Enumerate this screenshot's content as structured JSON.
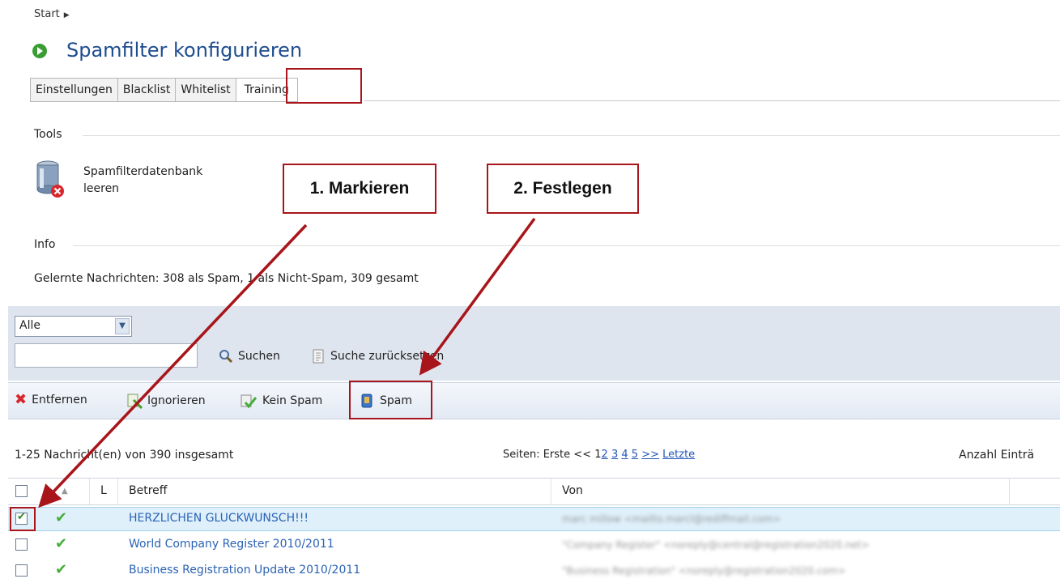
{
  "breadcrumb": {
    "start": "Start",
    "arrow": "▶"
  },
  "title": "Spamfilter konfigurieren",
  "tabs": [
    "Einstellungen",
    "Blacklist",
    "Whitelist",
    "Training"
  ],
  "active_tab": "Training",
  "tools": {
    "heading": "Tools",
    "db_line1": "Spamfilterdatenbank",
    "db_line2": "leeren",
    "db_icon": "database-delete-icon"
  },
  "annotations": {
    "step1": "1. Markieren",
    "step2": "2. Festlegen"
  },
  "info": {
    "heading": "Info",
    "text": "Gelernte Nachrichten: 308 als Spam, 1 als Nicht-Spam, 309 gesamt"
  },
  "filter": {
    "select_value": "Alle",
    "search_value": "",
    "search_label": "Suchen",
    "reset_label": "Suche zurücksetzen"
  },
  "toolbar": {
    "remove": "Entfernen",
    "ignore": "Ignorieren",
    "no_spam": "Kein Spam",
    "spam": "Spam"
  },
  "list": {
    "count": "1-25 Nachricht(en) von 390 insgesamt",
    "pager_prefix": "Seiten:",
    "pager_first": "Erste",
    "pager_prev": "<<",
    "pager_current": "1",
    "pager_pages": [
      "2",
      "3",
      "4",
      "5"
    ],
    "pager_next": ">>",
    "pager_last": "Letzte",
    "entries_label": "Anzahl Einträ"
  },
  "grid": {
    "headers": {
      "sort": "▲",
      "l": "L",
      "subject": "Betreff",
      "from": "Von"
    },
    "rows": [
      {
        "subject": "HERZLICHEN GLUCKWUNSCH!!!",
        "from": "marc millow <mailto.marcl@rediffmail.com>",
        "checked": true
      },
      {
        "subject": "World Company Register 2010/2011",
        "from": "\"Company Register\" <noreply@central@registration2020.net>",
        "checked": false
      },
      {
        "subject": "Business Registration Update 2010/2011",
        "from": "\"Business Registration\" <noreply@registration2020.com>",
        "checked": false
      }
    ]
  },
  "colors": {
    "accent": "#1f4d8f",
    "highlight": "#a8151a",
    "link": "#2b63b5",
    "ok": "#47ad3a"
  }
}
